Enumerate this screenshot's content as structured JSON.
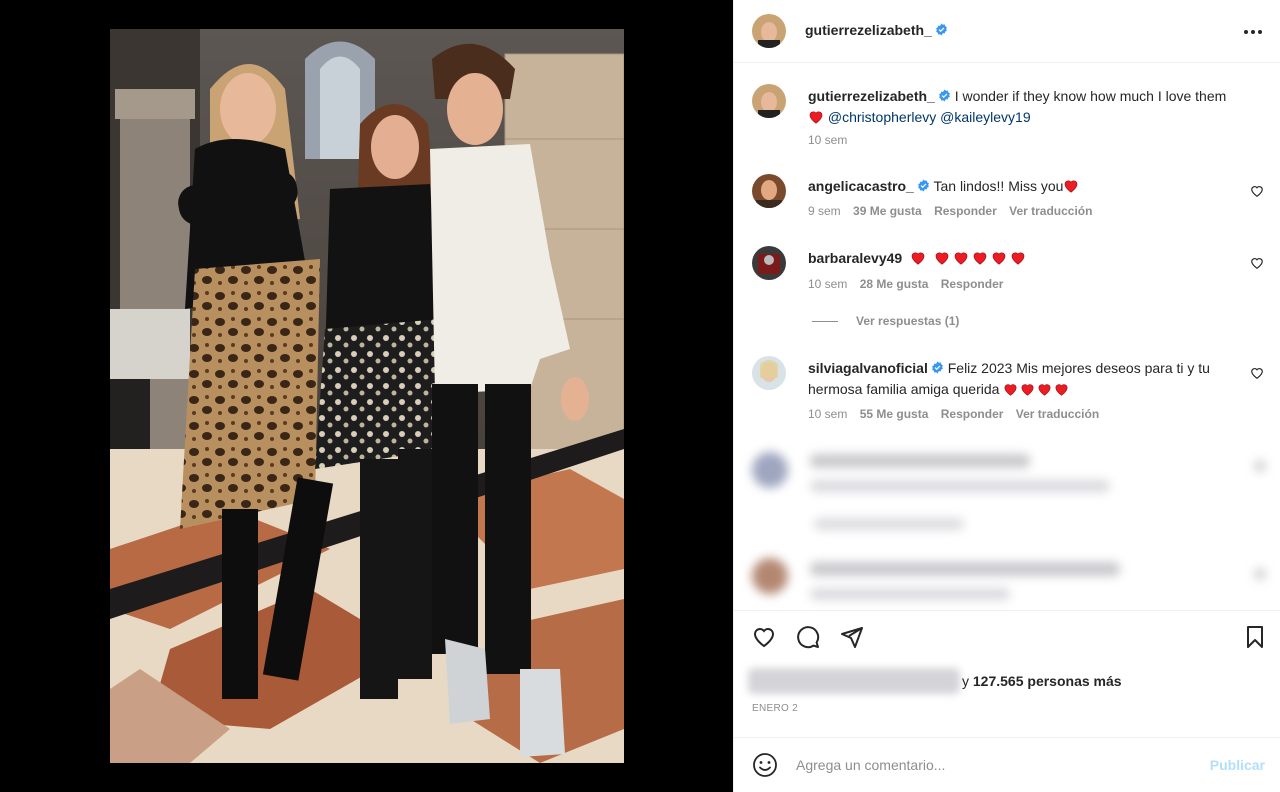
{
  "post": {
    "author": "gutierrezelizabeth_",
    "caption_text": "I wonder if they know how much I love them",
    "mentions": [
      "@christopherlevy",
      "@kaileylevy19"
    ],
    "caption_time": "10 sem"
  },
  "comments": [
    {
      "username": "angelicacastro_",
      "verified": true,
      "text": "Tan lindos!! Miss you",
      "time": "9 sem",
      "likes": "39 Me gusta",
      "reply": "Responder",
      "translate": "Ver traducción"
    },
    {
      "username": "barbaralevy49",
      "verified": false,
      "text": "",
      "time": "10 sem",
      "likes": "28 Me gusta",
      "reply": "Responder",
      "replies_label": "Ver respuestas (1)"
    },
    {
      "username": "silviagalvanoficial",
      "verified": true,
      "text": "Feliz 2023 Mis mejores deseos para ti y tu hermosa familia amiga querida",
      "time": "10 sem",
      "likes": "55 Me gusta",
      "reply": "Responder",
      "translate": "Ver traducción"
    }
  ],
  "likes_summary": {
    "prefix": "y",
    "count": "127.565 personas más"
  },
  "date": "ENERO 2",
  "comment_box": {
    "placeholder": "Agrega un comentario...",
    "publish": "Publicar"
  },
  "colors": {
    "verified_blue": "#3897f0",
    "heart_red": "#ed1c24",
    "mention_blue": "#00376b",
    "publish_disabled": "#b2dffc"
  },
  "icons": [
    "more-options-icon",
    "verified-icon",
    "heart-outline-icon",
    "comment-icon",
    "share-icon",
    "bookmark-icon",
    "emoji-icon",
    "red-heart-emoji"
  ]
}
